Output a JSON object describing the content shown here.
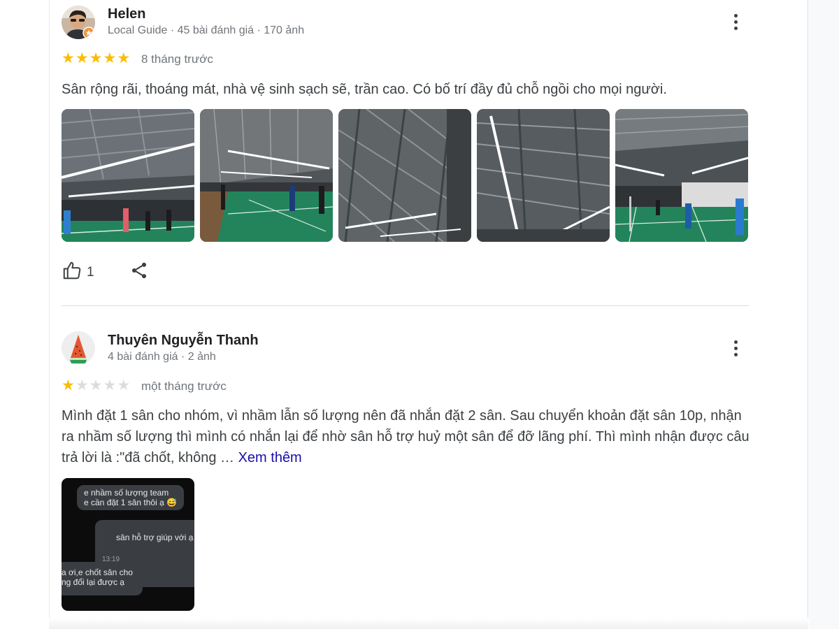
{
  "reviews": [
    {
      "author": "Helen",
      "meta": "Local Guide · 45 bài đánh giá · 170 ảnh",
      "rating": 5,
      "rating_max": 5,
      "time": "8 tháng trước",
      "text": "Sân rộng rãi, thoáng mát, nhà vệ sinh sạch sẽ, trần cao. Có bố trí đầy đủ chỗ ngồi cho mọi người.",
      "photo_count": 5,
      "likes": "1"
    },
    {
      "author": "Thuyên Nguyễn Thanh",
      "meta": "4 bài đánh giá · 2 ảnh",
      "rating": 1,
      "rating_max": 5,
      "time": "một tháng trước",
      "text": "Mình đặt 1 sân cho nhóm, vì nhầm lẫn số lượng nên đã nhắn đặt 2 sân. Sau chuyển khoản đặt sân 10p, nhận ra nhầm số lượng thì mình có nhắn lại để nhờ sân hỗ trợ huỷ một sân để đỡ lãng phí. Thì mình nhận được câu trả lời là :\"đã chốt, không …",
      "see_more": "Xem thêm",
      "chat_photo": {
        "bubble_1": "e nhầm số lượng team\ne cần đặt 1 sân thôi ạ 😅",
        "bubble_2": "sân hỗ trợ giúp với ạ",
        "bubble_2_time": "13:19",
        "bubble_3": "a ơi,e chốt sân cho\nng đổi lại được ạ"
      }
    }
  ],
  "colors": {
    "star": "#fbbc04",
    "star_empty": "#dadce0",
    "link": "#1a0dab",
    "court_green": "#1f8a5b",
    "divider": "#dadce0"
  },
  "icons": {
    "more": "more-vert-icon",
    "like": "thumb-up-icon",
    "share": "share-icon"
  }
}
